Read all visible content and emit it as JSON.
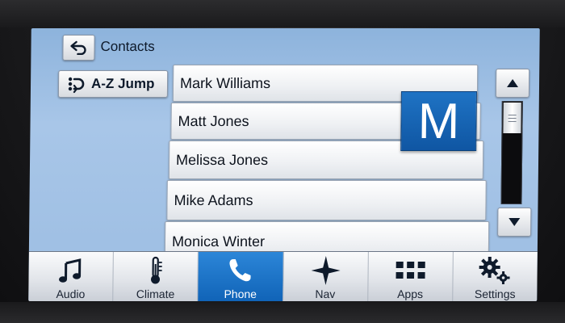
{
  "header": {
    "title": "Contacts",
    "back_icon": "back-arrow-icon"
  },
  "az_jump": {
    "label": "A-Z Jump",
    "icon": "voice-dial-icon"
  },
  "contacts": [
    {
      "name": "Mark Williams"
    },
    {
      "name": "Matt Jones"
    },
    {
      "name": "Melissa Jones"
    },
    {
      "name": "Mike Adams"
    },
    {
      "name": "Monica Winter"
    }
  ],
  "letter_indicator": "M",
  "scroll": {
    "up_icon": "triangle-up-icon",
    "down_icon": "triangle-down-icon"
  },
  "nav": {
    "items": [
      {
        "label": "Audio",
        "icon": "music-note-icon",
        "active": false
      },
      {
        "label": "Climate",
        "icon": "thermometer-icon",
        "active": false
      },
      {
        "label": "Phone",
        "icon": "phone-icon",
        "active": true
      },
      {
        "label": "Nav",
        "icon": "compass-star-icon",
        "active": false
      },
      {
        "label": "Apps",
        "icon": "grid-icon",
        "active": false
      },
      {
        "label": "Settings",
        "icon": "gears-icon",
        "active": false
      }
    ]
  },
  "colors": {
    "accent": "#1a6fc1",
    "background": "#9cbde2"
  }
}
